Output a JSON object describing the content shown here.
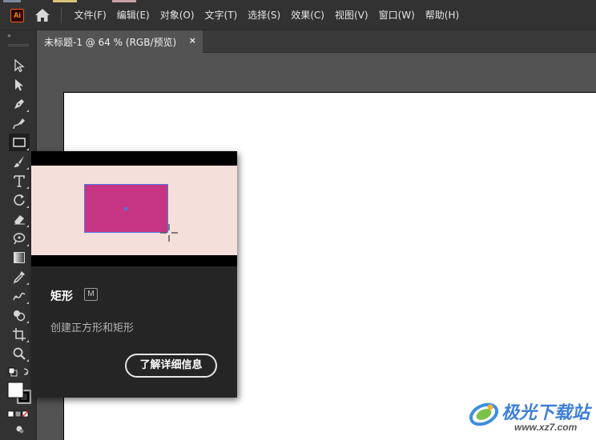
{
  "app": {
    "logo_text": "Ai",
    "logo_color": "#ff9a00"
  },
  "menu": {
    "items": [
      "文件(F)",
      "编辑(E)",
      "对象(O)",
      "文字(T)",
      "选择(S)",
      "效果(C)",
      "视图(V)",
      "窗口(W)",
      "帮助(H)"
    ]
  },
  "document_tab": {
    "title": "未标题-1 @ 64 % (RGB/预览)",
    "close_symbol": "×"
  },
  "toolbar": {
    "collapse_symbol": "»",
    "selected_tool": "rectangle-tool",
    "tools": [
      "selection-tool",
      "direct-selection-tool",
      "pen-tool",
      "curvature-tool",
      "rectangle-tool",
      "paintbrush-tool",
      "type-tool",
      "rotate-tool",
      "eraser-tool",
      "puppet-warp-tool",
      "gradient-tool",
      "eyedropper-tool",
      "blend-tool",
      "shape-builder-tool",
      "artboard-tool",
      "zoom-tool"
    ]
  },
  "tooltip": {
    "tool_name": "矩形",
    "shortcut_key": "M",
    "description": "创建正方形和矩形",
    "learn_more_label": "了解详细信息",
    "preview_rect_color": "#c63584",
    "preview_background": "#f5dfdb"
  },
  "watermark": {
    "text": "极光下载站",
    "url": "www.xz7.com"
  },
  "colors": {
    "ui_dark": "#323232",
    "canvas_gray": "#535353",
    "artboard": "#ffffff"
  }
}
